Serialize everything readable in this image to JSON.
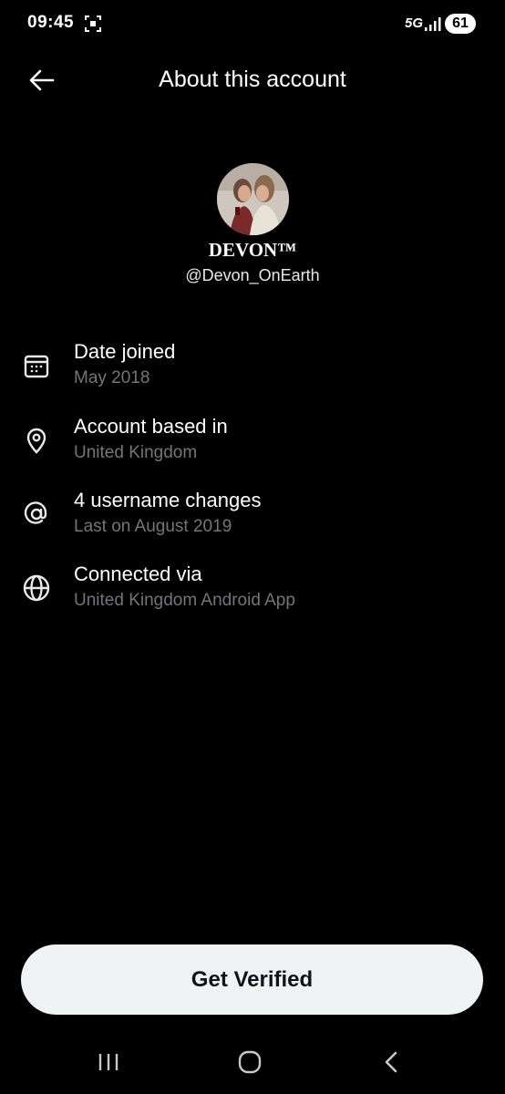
{
  "status_bar": {
    "time": "09:45",
    "network": "5G",
    "battery": "61",
    "icons": [
      "screenshot-icon",
      "signal-icon",
      "battery-icon"
    ]
  },
  "header": {
    "title": "About this account",
    "back_icon": "arrow-left-icon"
  },
  "profile": {
    "display_name": "DEVON™",
    "handle": "@Devon_OnEarth"
  },
  "info": [
    {
      "icon": "calendar-icon",
      "title": "Date joined",
      "subtitle": "May 2018"
    },
    {
      "icon": "location-pin-icon",
      "title": "Account based in",
      "subtitle": "United Kingdom"
    },
    {
      "icon": "at-sign-icon",
      "title": "4 username changes",
      "subtitle": "Last on August 2019"
    },
    {
      "icon": "globe-icon",
      "title": "Connected via",
      "subtitle": "United Kingdom Android App"
    }
  ],
  "actions": {
    "verify_label": "Get Verified"
  },
  "colors": {
    "background": "#000000",
    "primary_text": "#ffffff",
    "secondary_text": "#71767b",
    "button_bg": "#eff3f4",
    "button_text": "#0f1419"
  }
}
